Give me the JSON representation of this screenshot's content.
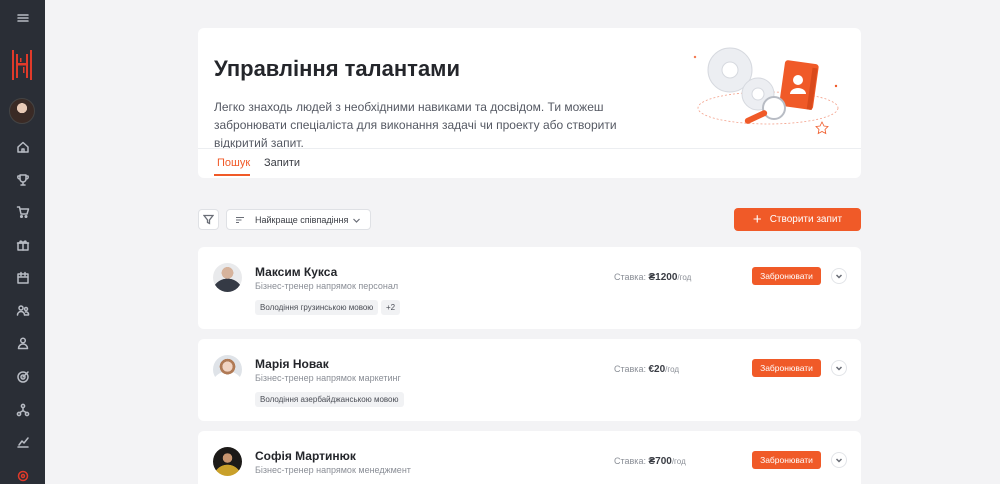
{
  "page": {
    "title": "Управління талантами",
    "description": "Легко знаходь людей з необхідними навиками та досвідом. Ти можеш забронювати спеціаліста для виконання задачі чи проекту або створити відкритий запит."
  },
  "tabs": [
    {
      "label": "Пошук",
      "active": true
    },
    {
      "label": "Запити",
      "active": false
    }
  ],
  "toolbar": {
    "sort_label": "Найкраще співпадіння",
    "create_label": "Створити запит"
  },
  "talents": [
    {
      "name": "Максим Кукса",
      "role": "Бізнес-тренер напрямок персонал",
      "rate_label": "Ставка:",
      "rate_value": "₴1200",
      "rate_unit": "/год",
      "skills": [
        "Володіння грузинською мовою",
        "+2"
      ],
      "book_label": "Забронювати"
    },
    {
      "name": "Марія Новак",
      "role": "Бізнес-тренер напрямок маркетинг",
      "rate_label": "Ставка:",
      "rate_value": "€20",
      "rate_unit": "/год",
      "skills": [
        "Володіння азербайджанською мовою"
      ],
      "book_label": "Забронювати"
    },
    {
      "name": "Софія Мартинюк",
      "role": "Бізнес-тренер напрямок менеджмент",
      "rate_label": "Ставка:",
      "rate_value": "₴700",
      "rate_unit": "/год",
      "skills": [],
      "book_label": "Забронювати"
    }
  ],
  "colors": {
    "accent": "#f05a28",
    "sidebar": "#2a2e36",
    "background": "#f3f3f5"
  },
  "sidebar": {
    "icons": [
      "menu-icon",
      "logo",
      "user-avatar",
      "home-icon",
      "trophy-icon",
      "cart-icon",
      "gift-icon",
      "calendar-icon",
      "people-icon",
      "person-icon",
      "target-icon",
      "network-icon",
      "chart-icon",
      "record-icon"
    ]
  }
}
